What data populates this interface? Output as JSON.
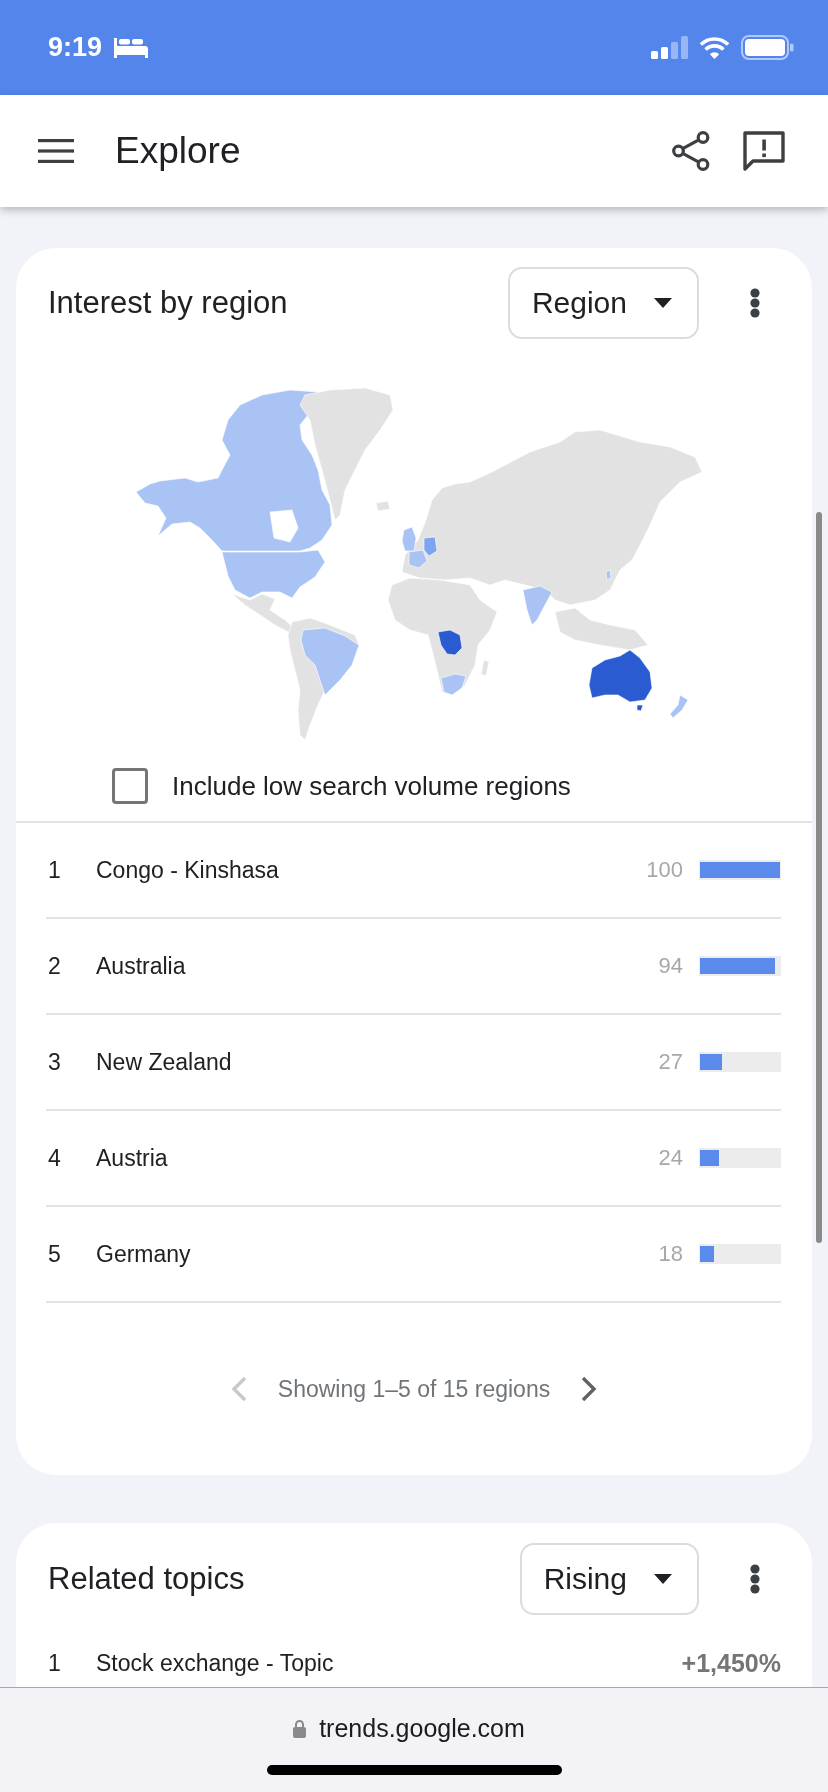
{
  "status_bar": {
    "time": "9:19"
  },
  "app_bar": {
    "title": "Explore"
  },
  "region_card": {
    "title": "Interest by region",
    "dropdown": {
      "value": "Region"
    },
    "low_volume_checkbox": {
      "label": "Include low search volume regions",
      "checked": false
    },
    "regions": [
      {
        "rank": "1",
        "name": "Congo - Kinshasa",
        "value": "100",
        "level": 1
      },
      {
        "rank": "2",
        "name": "Australia",
        "value": "94",
        "level": 0.94
      },
      {
        "rank": "3",
        "name": "New Zealand",
        "value": "27",
        "level": 0.27
      },
      {
        "rank": "4",
        "name": "Austria",
        "value": "24",
        "level": 0.24
      },
      {
        "rank": "5",
        "name": "Germany",
        "value": "18",
        "level": 0.18
      }
    ],
    "pagination": {
      "text": "Showing 1–5 of 15 regions",
      "prev_disabled": true,
      "next_disabled": false
    }
  },
  "related_topics_card": {
    "title": "Related topics",
    "dropdown": {
      "value": "Rising"
    },
    "topics": [
      {
        "rank": "1",
        "name": "Stock exchange - Topic",
        "value": "+1,450%"
      }
    ]
  },
  "browser_bar": {
    "url": "trends.google.com"
  }
}
